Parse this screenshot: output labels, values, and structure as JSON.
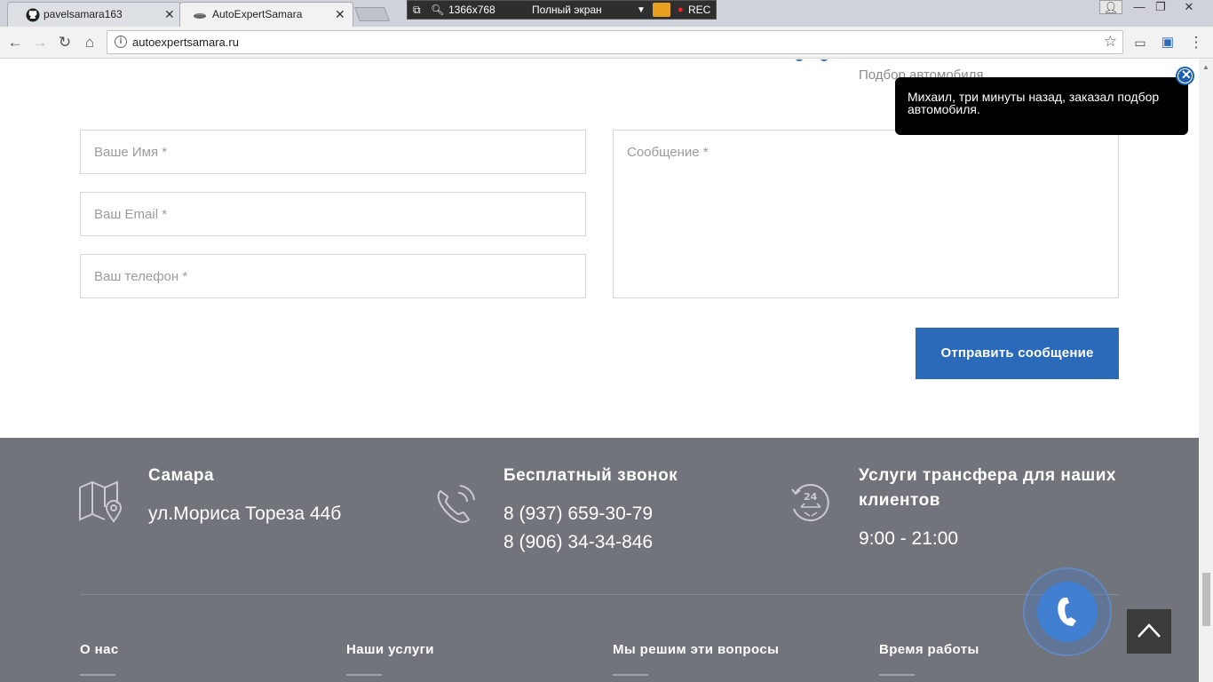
{
  "browser": {
    "tabs": [
      {
        "title": "pavelsamara163",
        "active": false
      },
      {
        "title": "AutoExpertSamara",
        "active": true
      }
    ],
    "recorder": {
      "resolution": "1366x768",
      "mode": "Полный экран",
      "rec_label": "REC"
    },
    "url": "autoexpertsamara.ru"
  },
  "top_fragment": {
    "text": "Подбор автомобиля"
  },
  "notification": {
    "text": "Михаил, три минуты назад, заказал подбор автомобиля."
  },
  "form": {
    "name_placeholder": "Ваше Имя *",
    "email_placeholder": "Ваш Email *",
    "phone_placeholder": "Ваш телефон *",
    "message_placeholder": "Сообщение *",
    "submit_label": "Отправить сообщение"
  },
  "footer": {
    "contacts": [
      {
        "title": "Самара",
        "lines": [
          "ул.Мориса Тореза 44б"
        ],
        "icon": "map-pin-icon"
      },
      {
        "title": "Бесплатный звонок",
        "lines": [
          "8 (937) 659-30-79",
          "8 (906) 34-34-846"
        ],
        "icon": "phone-ringing-icon"
      },
      {
        "title": "Услуги трансфера для наших клиентов",
        "lines": [
          "9:00 - 21:00"
        ],
        "icon": "clock-24-icon"
      }
    ],
    "columns": [
      "О нас",
      "Наши услуги",
      "Мы решим эти вопросы",
      "Время работы"
    ]
  },
  "colors": {
    "accent": "#2a6ab8",
    "footer_bg": "#71747b",
    "toast_bg": "#000000"
  }
}
